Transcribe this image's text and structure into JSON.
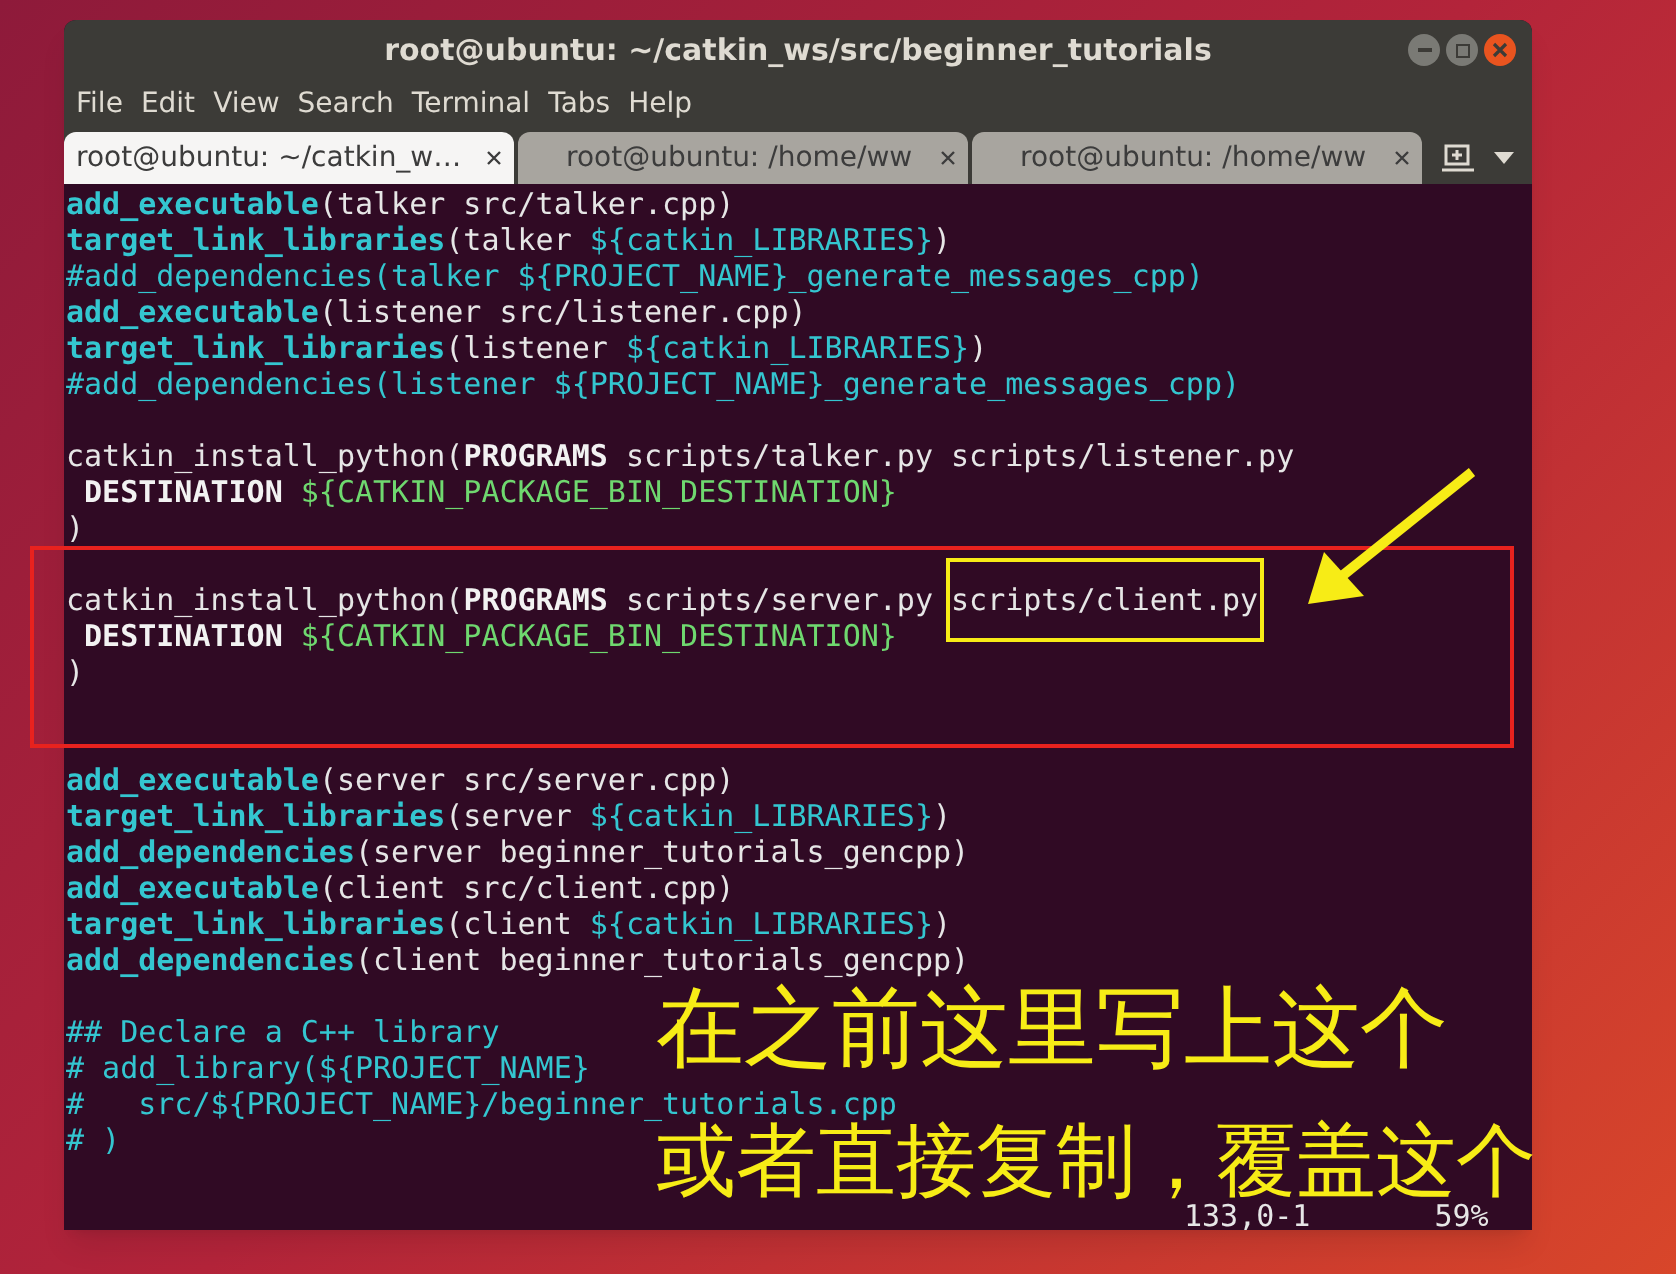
{
  "window": {
    "title": "root@ubuntu: ~/catkin_ws/src/beginner_tutorials"
  },
  "menu": [
    "File",
    "Edit",
    "View",
    "Search",
    "Terminal",
    "Tabs",
    "Help"
  ],
  "tabs": [
    {
      "label": "root@ubuntu: ~/catkin_w…",
      "selected": true
    },
    {
      "label": "root@ubuntu: /home/ww",
      "selected": false
    },
    {
      "label": "root@ubuntu: /home/ww",
      "selected": false
    }
  ],
  "code_lines": [
    {
      "kind": "code",
      "segments": [
        {
          "kind": "fn",
          "text": "add_executable"
        },
        {
          "kind": "plain",
          "text": "(talker src/talker.cpp)"
        }
      ]
    },
    {
      "kind": "code",
      "segments": [
        {
          "kind": "fn",
          "text": "target_link_libraries"
        },
        {
          "kind": "plain",
          "text": "(talker "
        },
        {
          "kind": "var",
          "text": "${catkin_LIBRARIES}"
        },
        {
          "kind": "plain",
          "text": ")"
        }
      ]
    },
    {
      "kind": "code",
      "segments": [
        {
          "kind": "comment",
          "text": "#add_dependencies(talker ${PROJECT_NAME}_generate_messages_cpp)"
        }
      ]
    },
    {
      "kind": "code",
      "segments": [
        {
          "kind": "fn",
          "text": "add_executable"
        },
        {
          "kind": "plain",
          "text": "(listener src/listener.cpp)"
        }
      ]
    },
    {
      "kind": "code",
      "segments": [
        {
          "kind": "fn",
          "text": "target_link_libraries"
        },
        {
          "kind": "plain",
          "text": "(listener "
        },
        {
          "kind": "var",
          "text": "${catkin_LIBRARIES}"
        },
        {
          "kind": "plain",
          "text": ")"
        }
      ]
    },
    {
      "kind": "code",
      "segments": [
        {
          "kind": "comment",
          "text": "#add_dependencies(listener ${PROJECT_NAME}_generate_messages_cpp)"
        }
      ]
    },
    {
      "kind": "blank"
    },
    {
      "kind": "code",
      "segments": [
        {
          "kind": "plain",
          "text": "catkin_install_python("
        },
        {
          "kind": "keyword",
          "text": "PROGRAMS"
        },
        {
          "kind": "plain",
          "text": " scripts/talker.py scripts/listener.py"
        }
      ]
    },
    {
      "kind": "code",
      "segments": [
        {
          "kind": "keyword",
          "text": " DESTINATION"
        },
        {
          "kind": "green",
          "text": " ${CATKIN_PACKAGE_BIN_DESTINATION}"
        }
      ]
    },
    {
      "kind": "code",
      "segments": [
        {
          "kind": "plain",
          "text": ")"
        }
      ]
    },
    {
      "kind": "blank"
    },
    {
      "kind": "code",
      "segments": [
        {
          "kind": "plain",
          "text": "catkin_install_python("
        },
        {
          "kind": "keyword",
          "text": "PROGRAMS"
        },
        {
          "kind": "plain",
          "text": " scripts/server.py "
        },
        {
          "kind": "boxed",
          "text": "scripts/client.py"
        }
      ]
    },
    {
      "kind": "code",
      "segments": [
        {
          "kind": "keyword",
          "text": " DESTINATION"
        },
        {
          "kind": "green",
          "text": " ${CATKIN_PACKAGE_BIN_DESTINATION}"
        }
      ]
    },
    {
      "kind": "code",
      "segments": [
        {
          "kind": "plain",
          "text": ")"
        }
      ]
    },
    {
      "kind": "blank"
    },
    {
      "kind": "blank"
    },
    {
      "kind": "code",
      "segments": [
        {
          "kind": "fn",
          "text": "add_executable"
        },
        {
          "kind": "plain",
          "text": "(server src/server.cpp)"
        }
      ]
    },
    {
      "kind": "code",
      "segments": [
        {
          "kind": "fn",
          "text": "target_link_libraries"
        },
        {
          "kind": "plain",
          "text": "(server "
        },
        {
          "kind": "var",
          "text": "${catkin_LIBRARIES}"
        },
        {
          "kind": "plain",
          "text": ")"
        }
      ]
    },
    {
      "kind": "code",
      "segments": [
        {
          "kind": "fn",
          "text": "add_dependencies"
        },
        {
          "kind": "plain",
          "text": "(server beginner_tutorials_gencpp)"
        }
      ]
    },
    {
      "kind": "code",
      "segments": [
        {
          "kind": "fn",
          "text": "add_executable"
        },
        {
          "kind": "plain",
          "text": "(client src/client.cpp)"
        }
      ]
    },
    {
      "kind": "code",
      "segments": [
        {
          "kind": "fn",
          "text": "target_link_libraries"
        },
        {
          "kind": "plain",
          "text": "(client "
        },
        {
          "kind": "var",
          "text": "${catkin_LIBRARIES}"
        },
        {
          "kind": "plain",
          "text": ")"
        }
      ]
    },
    {
      "kind": "code",
      "segments": [
        {
          "kind": "fn",
          "text": "add_dependencies"
        },
        {
          "kind": "plain",
          "text": "(client beginner_tutorials_gencpp)"
        }
      ]
    },
    {
      "kind": "blank"
    },
    {
      "kind": "code",
      "segments": [
        {
          "kind": "comment",
          "text": "## Declare a C++ library"
        }
      ]
    },
    {
      "kind": "code",
      "segments": [
        {
          "kind": "comment",
          "text": "# add_library(${PROJECT_NAME}"
        }
      ]
    },
    {
      "kind": "code",
      "segments": [
        {
          "kind": "comment",
          "text": "#   src/${PROJECT_NAME}/beginner_tutorials.cpp"
        }
      ]
    },
    {
      "kind": "code",
      "segments": [
        {
          "kind": "comment",
          "text": "# )"
        }
      ]
    },
    {
      "kind": "blank"
    }
  ],
  "status_bar": {
    "position": "133,0-1",
    "percent": "59%"
  },
  "caption": [
    "在之前这里写上这个",
    "或者直接复制，覆盖这个"
  ]
}
